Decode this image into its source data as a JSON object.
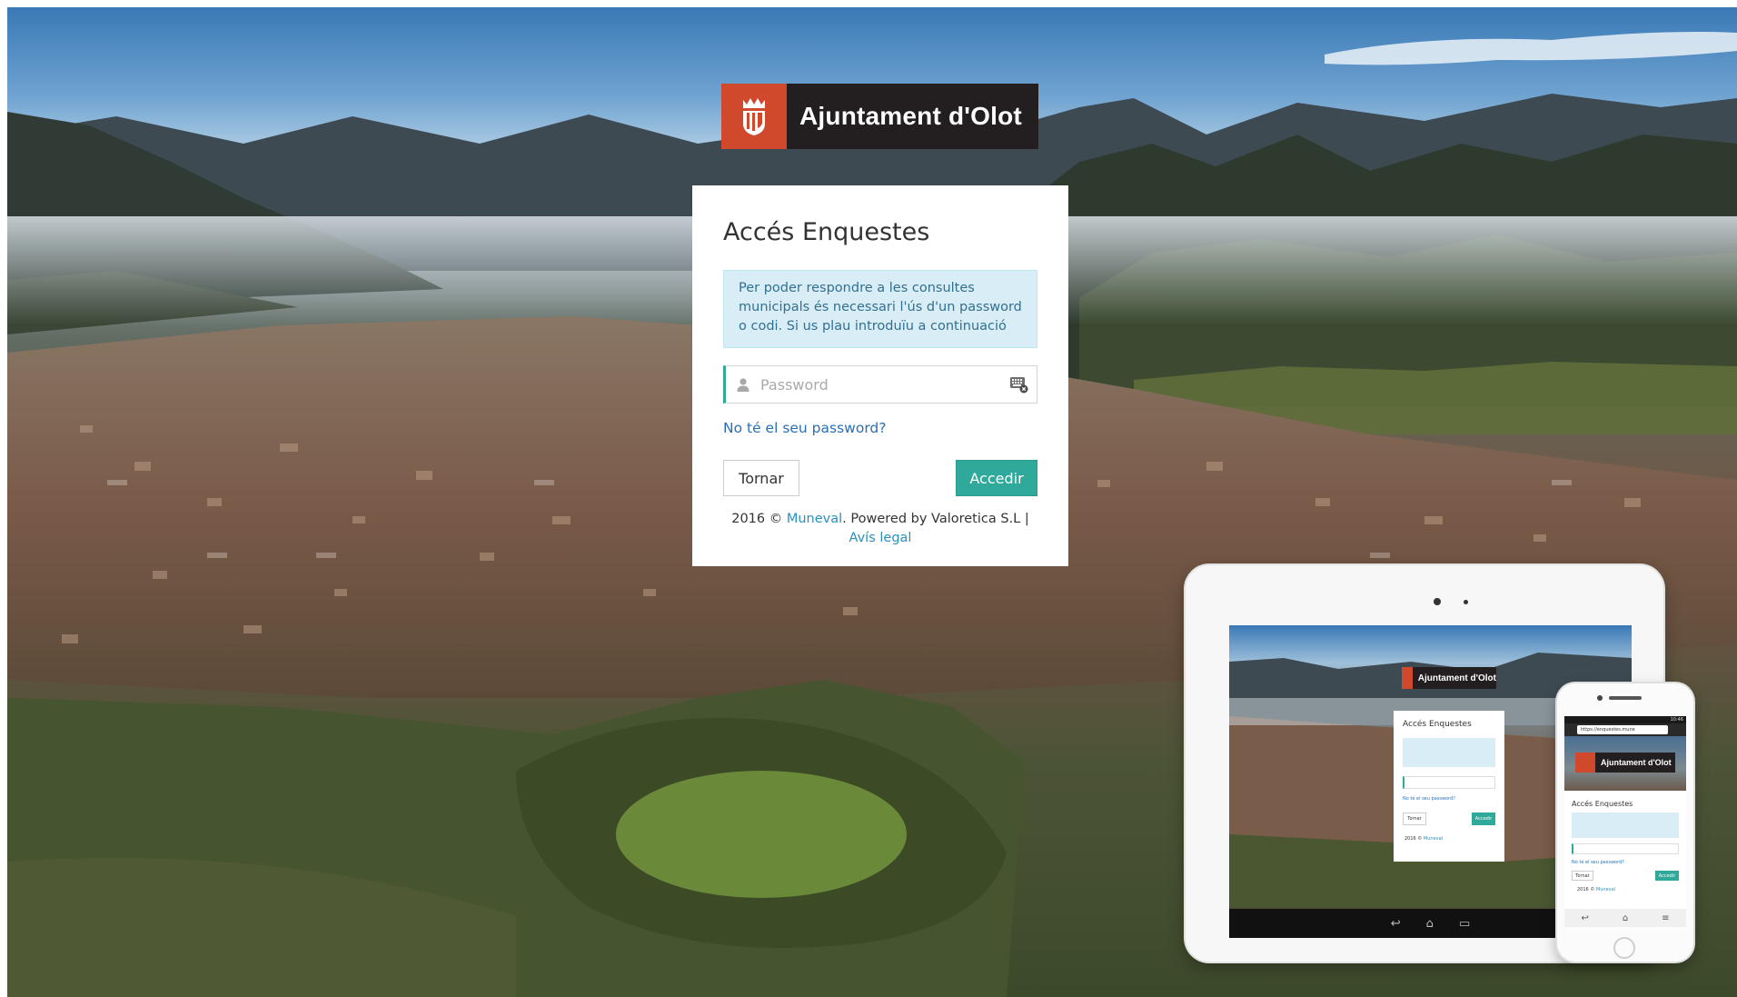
{
  "brand": {
    "name": "Ajuntament d'Olot",
    "accent_color": "#d1492c",
    "bar_color": "#231f20"
  },
  "login": {
    "title": "Accés Enquestes",
    "info_message": "Per poder respondre a les consultes municipals és necessari l'ús d'un password o codi. Si us plau introduïu a continuació",
    "password_placeholder": "Password",
    "password_value": "",
    "forgot_link": "No té el seu password?",
    "back_button": "Tornar",
    "submit_button": "Accedir",
    "primary_color": "#2fa99a"
  },
  "footer": {
    "year": "2016 ©",
    "company_link": "Muneval",
    "powered_by": ". Powered by Valoretica S.L |",
    "legal_link": "Avís legal"
  },
  "icons": {
    "user": "user-icon",
    "keyboard": "keyboard-icon",
    "logo": "coat-of-arms-icon"
  },
  "devices": {
    "phone_url": "https://enquestes.mune",
    "phone_clock": "10:46"
  }
}
